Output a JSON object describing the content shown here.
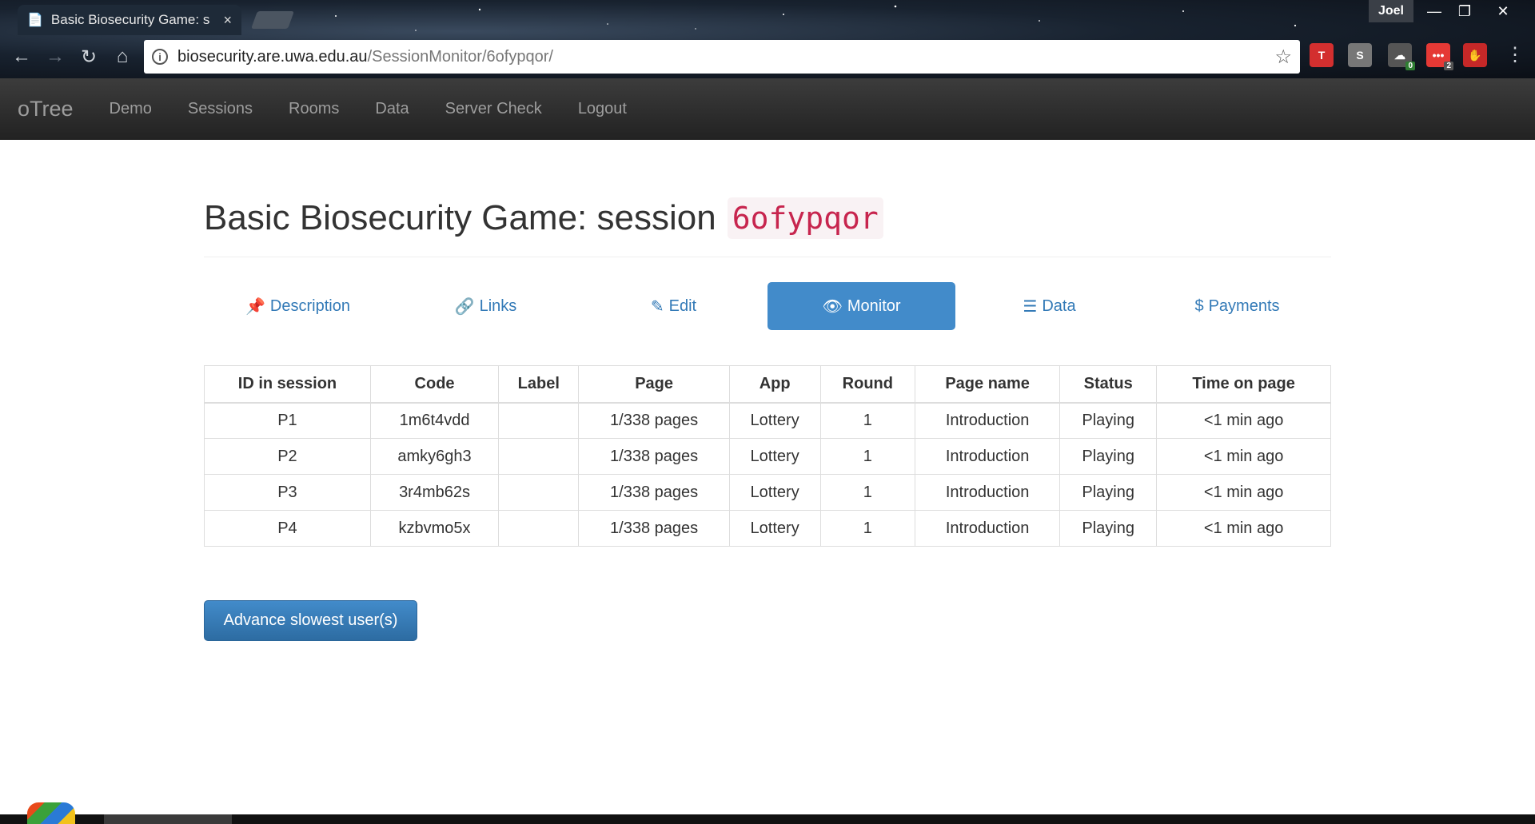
{
  "browser": {
    "tab_title": "Basic Biosecurity Game: s",
    "tab_close": "×",
    "profile_name": "Joel",
    "window_controls": [
      "—",
      "❐",
      "✕"
    ],
    "url_host": "biosecurity.are.uwa.edu.au",
    "url_path": "/SessionMonitor/6ofypqor/",
    "extensions": [
      {
        "name": "t-extension-icon",
        "glyph": "T",
        "color": "#d32f2f",
        "badge": ""
      },
      {
        "name": "s-extension-icon",
        "glyph": "S",
        "color": "#777777",
        "badge": ""
      },
      {
        "name": "cloud-extension-icon",
        "glyph": "☁",
        "color": "#555555",
        "badge": "0"
      },
      {
        "name": "dots-extension-icon",
        "glyph": "•••",
        "color": "#e53935",
        "badge": "2"
      },
      {
        "name": "ublock-extension-icon",
        "glyph": "✋",
        "color": "#c62828",
        "badge": ""
      }
    ]
  },
  "navbar": {
    "brand": "oTree",
    "links": [
      "Demo",
      "Sessions",
      "Rooms",
      "Data",
      "Server Check",
      "Logout"
    ]
  },
  "page": {
    "title": "Basic Biosecurity Game: session",
    "session_code": "6ofypqor"
  },
  "pills": [
    {
      "label": "Description",
      "icon": "pushpin-icon",
      "glyph": "📌",
      "active": false
    },
    {
      "label": "Links",
      "icon": "link-icon",
      "glyph": "🔗",
      "active": false
    },
    {
      "label": "Edit",
      "icon": "pencil-icon",
      "glyph": "✎",
      "active": false
    },
    {
      "label": "Monitor",
      "icon": "eye-icon",
      "glyph": "👁",
      "active": true
    },
    {
      "label": "Data",
      "icon": "list-icon",
      "glyph": "☰",
      "active": false
    },
    {
      "label": "Payments",
      "icon": "dollar-icon",
      "glyph": "$",
      "active": false
    }
  ],
  "table": {
    "headers": [
      "ID in session",
      "Code",
      "Label",
      "Page",
      "App",
      "Round",
      "Page name",
      "Status",
      "Time on page"
    ],
    "rows": [
      [
        "P1",
        "1m6t4vdd",
        "",
        "1/338 pages",
        "Lottery",
        "1",
        "Introduction",
        "Playing",
        "<1 min ago"
      ],
      [
        "P2",
        "amky6gh3",
        "",
        "1/338 pages",
        "Lottery",
        "1",
        "Introduction",
        "Playing",
        "<1 min ago"
      ],
      [
        "P3",
        "3r4mb62s",
        "",
        "1/338 pages",
        "Lottery",
        "1",
        "Introduction",
        "Playing",
        "<1 min ago"
      ],
      [
        "P4",
        "kzbvmo5x",
        "",
        "1/338 pages",
        "Lottery",
        "1",
        "Introduction",
        "Playing",
        "<1 min ago"
      ]
    ]
  },
  "advance_button": "Advance slowest user(s)"
}
